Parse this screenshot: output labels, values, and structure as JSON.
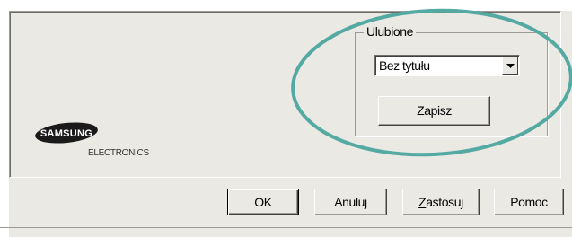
{
  "favorites": {
    "group_title": "Ulubione",
    "selected_value": "Bez tytułu",
    "save_label": "Zapisz"
  },
  "logo": {
    "brand": "SAMSUNG",
    "sub": "ELECTRONICS"
  },
  "buttons": {
    "ok": "OK",
    "cancel": "Anuluj",
    "apply_mnemonic": "Z",
    "apply_rest": "astosuj",
    "help": "Pomoc"
  },
  "highlight_color": "#54aaa2"
}
